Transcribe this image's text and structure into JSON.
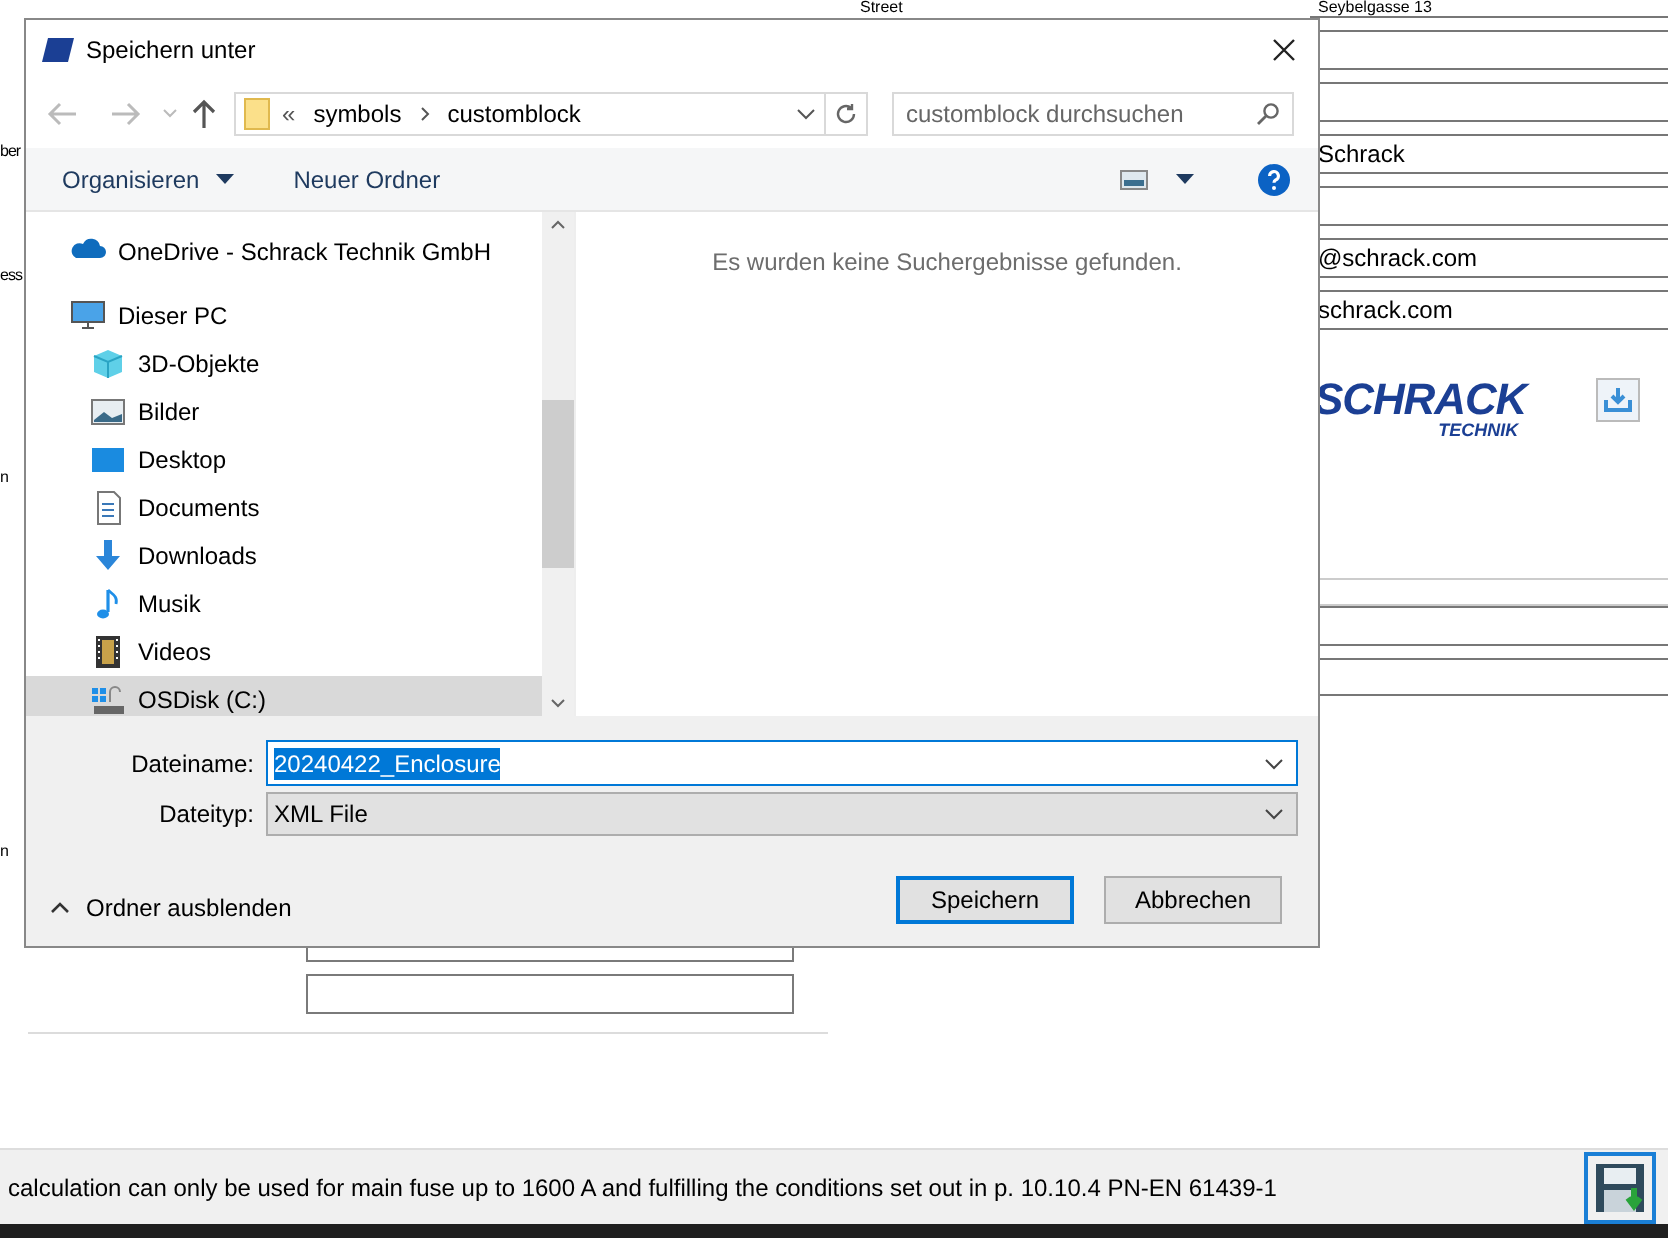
{
  "background": {
    "street_label": "Street",
    "left_labels": [
      "ber",
      "ess",
      "n",
      "n"
    ],
    "right_fields": [
      {
        "kind": "text",
        "value": "Seybelgasse 13"
      },
      {
        "kind": "blank"
      },
      {
        "kind": "blank"
      },
      {
        "kind": "text",
        "value": "Schrack"
      },
      {
        "kind": "blank"
      },
      {
        "kind": "text",
        "value": "@schrack.com"
      },
      {
        "kind": "text",
        "value": "schrack.com"
      }
    ],
    "logo": {
      "name": "SCHRACK",
      "subtitle": "TECHNIK"
    },
    "status_text": "calculation can only be used for main fuse up to 1600 A and fulfilling the conditions set out in p. 10.10.4 PN-EN 61439-1"
  },
  "dialog": {
    "title": "Speichern unter",
    "address": {
      "overflow": "«",
      "crumbs": [
        "symbols",
        "customblock"
      ]
    },
    "search": {
      "placeholder": "customblock durchsuchen"
    },
    "toolbar": [
      "Organisieren",
      "Neuer Ordner"
    ],
    "nav": [
      {
        "label": "OneDrive - Schrack Technik GmbH",
        "kind": "cloud",
        "selected": false
      },
      {
        "label": "Dieser PC",
        "kind": "pc",
        "selected": false,
        "children": [
          {
            "label": "3D-Objekte",
            "kind": "cube",
            "selected": false
          },
          {
            "label": "Bilder",
            "kind": "pictures",
            "selected": false
          },
          {
            "label": "Desktop",
            "kind": "desktop",
            "selected": false
          },
          {
            "label": "Documents",
            "kind": "document",
            "selected": false
          },
          {
            "label": "Downloads",
            "kind": "download",
            "selected": false
          },
          {
            "label": "Musik",
            "kind": "music",
            "selected": false
          },
          {
            "label": "Videos",
            "kind": "video",
            "selected": false
          },
          {
            "label": "OSDisk (C:)",
            "kind": "disk",
            "selected": true
          }
        ]
      }
    ],
    "empty_message": "Es wurden keine Suchergebnisse gefunden.",
    "filename": {
      "label": "Dateiname:",
      "value": "20240422_Enclosure"
    },
    "filetype": {
      "label": "Dateityp:",
      "value": "XML File"
    },
    "hide_folders": "Ordner ausblenden",
    "buttons": [
      {
        "label": "Speichern",
        "default": true
      },
      {
        "label": "Abbrechen",
        "default": false
      }
    ]
  }
}
